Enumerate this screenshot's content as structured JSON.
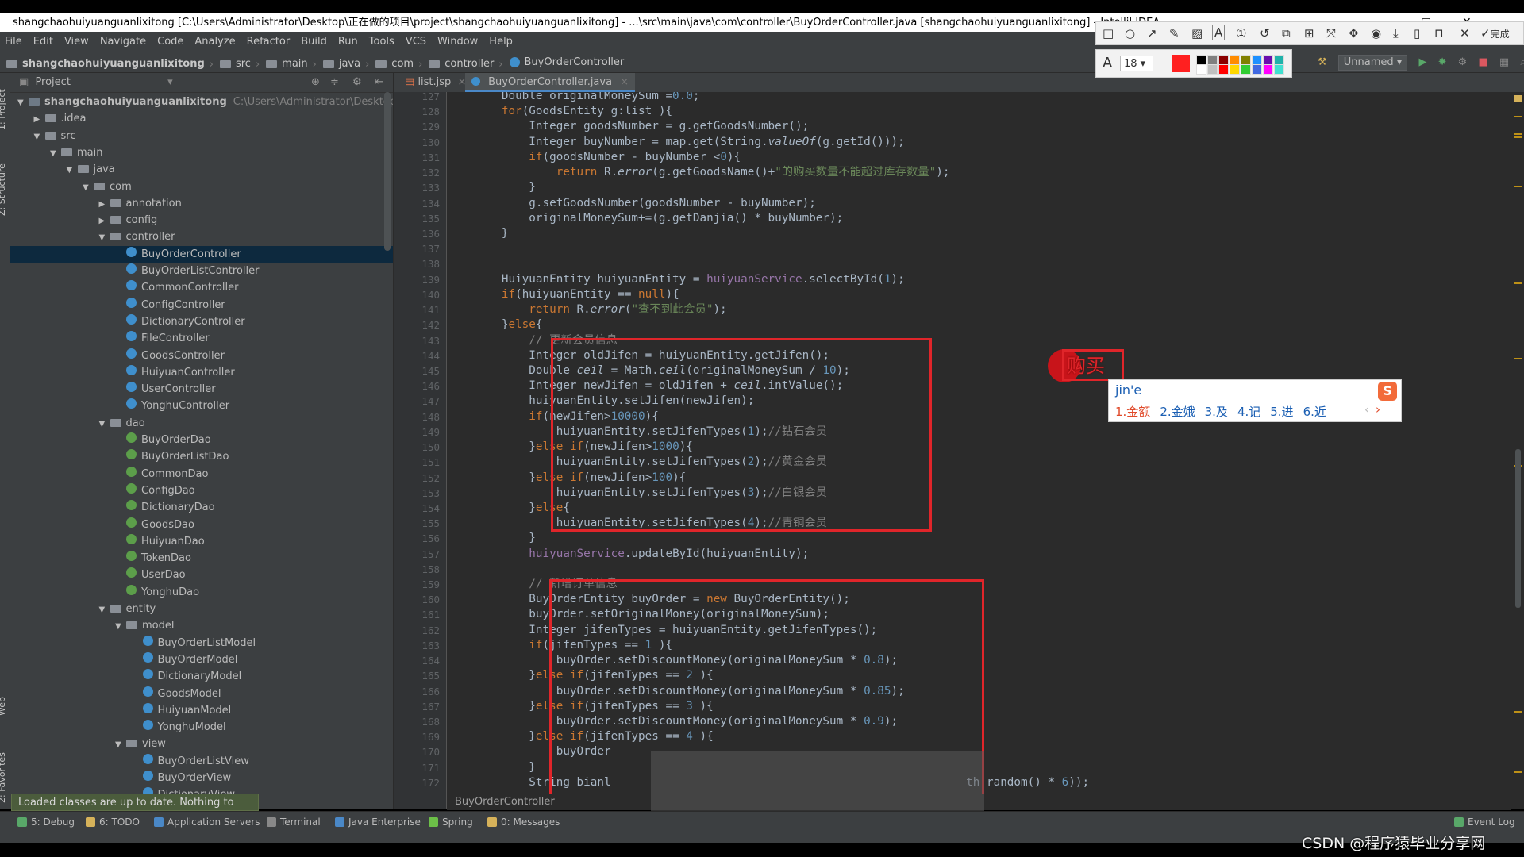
{
  "window_title": "shangchaohuiyuanguanlixitong [C:\\Users\\Administrator\\Desktop\\正在做的项目\\project\\shangchaohuiyuanguanlixitong] - ...\\src\\main\\java\\com\\controller\\BuyOrderController.java [shangchaohuiyuanguanlixitong] - IntelliJ IDEA",
  "menu": [
    "File",
    "Edit",
    "View",
    "Navigate",
    "Code",
    "Analyze",
    "Refactor",
    "Build",
    "Run",
    "Tools",
    "VCS",
    "Window",
    "Help"
  ],
  "breadcrumbs": [
    "shangchaohuiyuanguanlixitong",
    "src",
    "main",
    "java",
    "com",
    "controller",
    "BuyOrderController"
  ],
  "run_config": "Unnamed",
  "project_panel": {
    "title": "Project",
    "root_name": "shangchaohuiyuanguanlixitong",
    "root_path": "C:\\Users\\Administrator\\Desktop\\正在做",
    "tree": [
      {
        "label": "shangchaohuiyuanguanlixitong",
        "depth": 0,
        "kind": "module",
        "arrow": "▼"
      },
      {
        "label": ".idea",
        "depth": 1,
        "kind": "folder",
        "arrow": "▶"
      },
      {
        "label": "src",
        "depth": 1,
        "kind": "folder",
        "arrow": "▼"
      },
      {
        "label": "main",
        "depth": 2,
        "kind": "folder",
        "arrow": "▼"
      },
      {
        "label": "java",
        "depth": 3,
        "kind": "folder",
        "arrow": "▼"
      },
      {
        "label": "com",
        "depth": 4,
        "kind": "folder",
        "arrow": "▼"
      },
      {
        "label": "annotation",
        "depth": 5,
        "kind": "folder",
        "arrow": "▶"
      },
      {
        "label": "config",
        "depth": 5,
        "kind": "folder",
        "arrow": "▶"
      },
      {
        "label": "controller",
        "depth": 5,
        "kind": "folder",
        "arrow": "▼"
      },
      {
        "label": "BuyOrderController",
        "depth": 6,
        "kind": "class",
        "arrow": "",
        "selected": true
      },
      {
        "label": "BuyOrderListController",
        "depth": 6,
        "kind": "class",
        "arrow": ""
      },
      {
        "label": "CommonController",
        "depth": 6,
        "kind": "class",
        "arrow": ""
      },
      {
        "label": "ConfigController",
        "depth": 6,
        "kind": "class",
        "arrow": ""
      },
      {
        "label": "DictionaryController",
        "depth": 6,
        "kind": "class",
        "arrow": ""
      },
      {
        "label": "FileController",
        "depth": 6,
        "kind": "class",
        "arrow": ""
      },
      {
        "label": "GoodsController",
        "depth": 6,
        "kind": "class",
        "arrow": ""
      },
      {
        "label": "HuiyuanController",
        "depth": 6,
        "kind": "class",
        "arrow": ""
      },
      {
        "label": "UserController",
        "depth": 6,
        "kind": "class",
        "arrow": ""
      },
      {
        "label": "YonghuController",
        "depth": 6,
        "kind": "class",
        "arrow": ""
      },
      {
        "label": "dao",
        "depth": 5,
        "kind": "folder",
        "arrow": "▼"
      },
      {
        "label": "BuyOrderDao",
        "depth": 6,
        "kind": "interface",
        "arrow": ""
      },
      {
        "label": "BuyOrderListDao",
        "depth": 6,
        "kind": "interface",
        "arrow": ""
      },
      {
        "label": "CommonDao",
        "depth": 6,
        "kind": "interface",
        "arrow": ""
      },
      {
        "label": "ConfigDao",
        "depth": 6,
        "kind": "interface",
        "arrow": ""
      },
      {
        "label": "DictionaryDao",
        "depth": 6,
        "kind": "interface",
        "arrow": ""
      },
      {
        "label": "GoodsDao",
        "depth": 6,
        "kind": "interface",
        "arrow": ""
      },
      {
        "label": "HuiyuanDao",
        "depth": 6,
        "kind": "interface",
        "arrow": ""
      },
      {
        "label": "TokenDao",
        "depth": 6,
        "kind": "interface",
        "arrow": ""
      },
      {
        "label": "UserDao",
        "depth": 6,
        "kind": "interface",
        "arrow": ""
      },
      {
        "label": "YonghuDao",
        "depth": 6,
        "kind": "interface",
        "arrow": ""
      },
      {
        "label": "entity",
        "depth": 5,
        "kind": "folder",
        "arrow": "▼"
      },
      {
        "label": "model",
        "depth": 6,
        "kind": "folder",
        "arrow": "▼"
      },
      {
        "label": "BuyOrderListModel",
        "depth": 7,
        "kind": "class",
        "arrow": ""
      },
      {
        "label": "BuyOrderModel",
        "depth": 7,
        "kind": "class",
        "arrow": ""
      },
      {
        "label": "DictionaryModel",
        "depth": 7,
        "kind": "class",
        "arrow": ""
      },
      {
        "label": "GoodsModel",
        "depth": 7,
        "kind": "class",
        "arrow": ""
      },
      {
        "label": "HuiyuanModel",
        "depth": 7,
        "kind": "class",
        "arrow": ""
      },
      {
        "label": "YonghuModel",
        "depth": 7,
        "kind": "class",
        "arrow": ""
      },
      {
        "label": "view",
        "depth": 6,
        "kind": "folder",
        "arrow": "▼"
      },
      {
        "label": "BuyOrderListView",
        "depth": 7,
        "kind": "class",
        "arrow": ""
      },
      {
        "label": "BuyOrderView",
        "depth": 7,
        "kind": "class",
        "arrow": ""
      },
      {
        "label": "DictionaryView",
        "depth": 7,
        "kind": "class",
        "arrow": ""
      }
    ]
  },
  "left_tool_tabs": [
    "1: Project",
    "Z: Structure",
    "Web",
    "2: Favorites"
  ],
  "editor_tabs": [
    {
      "label": "list.jsp",
      "active": false
    },
    {
      "label": "BuyOrderController.java",
      "active": true
    }
  ],
  "code": {
    "first_line": 127,
    "lines": [
      "        Double originalMoneySum =0.0;",
      "        for(GoodsEntity g:list ){",
      "            Integer goodsNumber = g.getGoodsNumber();",
      "            Integer buyNumber = map.get(String.valueOf(g.getId()));",
      "            if(goodsNumber - buyNumber <0){",
      "                return R.error(g.getGoodsName()+\"的购买数量不能超过库存数量\");",
      "            }",
      "            g.setGoodsNumber(goodsNumber - buyNumber);",
      "            originalMoneySum+=(g.getDanjia() * buyNumber);",
      "        }",
      "",
      "",
      "        HuiyuanEntity huiyuanEntity = huiyuanService.selectById(1);",
      "        if(huiyuanEntity == null){",
      "            return R.error(\"查不到此会员\");",
      "        }else{",
      "            // 更新会员信息",
      "            Integer oldJifen = huiyuanEntity.getJifen();",
      "            Double ceil = Math.ceil(originalMoneySum / 10);",
      "            Integer newJifen = oldJifen + ceil.intValue();",
      "            huiyuanEntity.setJifen(newJifen);",
      "            if(newJifen>10000){",
      "                huiyuanEntity.setJifenTypes(1);//钻石会员",
      "            }else if(newJifen>1000){",
      "                huiyuanEntity.setJifenTypes(2);//黄金会员",
      "            }else if(newJifen>100){",
      "                huiyuanEntity.setJifenTypes(3);//白银会员",
      "            }else{",
      "                huiyuanEntity.setJifenTypes(4);//青铜会员",
      "            }",
      "            huiyuanService.updateById(huiyuanEntity);",
      "",
      "            // 新增订单信息",
      "            BuyOrderEntity buyOrder = new BuyOrderEntity();",
      "            buyOrder.setOriginalMoney(originalMoneySum);",
      "            Integer jifenTypes = huiyuanEntity.getJifenTypes();",
      "            if(jifenTypes == 1 ){",
      "                buyOrder.setDiscountMoney(originalMoneySum * 0.8);",
      "            }else if(jifenTypes == 2 ){",
      "                buyOrder.setDiscountMoney(originalMoneySum * 0.85);",
      "            }else if(jifenTypes == 3 ){",
      "                buyOrder.setDiscountMoney(originalMoneySum * 0.9);",
      "            }else if(jifenTypes == 4 ){",
      "                buyOrder",
      "            }",
      "            String bianl                                                    th.random() * 6));"
    ]
  },
  "editor_breadcrumb": "BuyOrderController",
  "notification": "Loaded classes are up to date. Nothing to reload.",
  "bottom_tabs": [
    {
      "label": "5: Debug",
      "icon": "bug-icon"
    },
    {
      "label": "6: TODO",
      "icon": "todo-icon"
    },
    {
      "label": "Application Servers",
      "icon": "server-icon"
    },
    {
      "label": "Terminal",
      "icon": "terminal-icon"
    },
    {
      "label": "Java Enterprise",
      "icon": "java-ee-icon"
    },
    {
      "label": "Spring",
      "icon": "spring-icon"
    },
    {
      "label": "0: Messages",
      "icon": "messages-icon"
    }
  ],
  "event_log": "Event Log",
  "screenshot_tool": {
    "font_size": "18",
    "done_label": "完成",
    "colors": [
      "#ff2020",
      "#000000",
      "#808080",
      "#8b0000",
      "#ff8c00",
      "#808000",
      "#1e90ff",
      "#6a0dad",
      "#20b2aa",
      "#ffffff",
      "#c0c0c0",
      "#ff0000",
      "#ffd700",
      "#32cd32",
      "#4169e1",
      "#ff00ff",
      "#40e0d0"
    ]
  },
  "annotation_badge": "购买",
  "ime": {
    "pinyin": "jin'e",
    "candidates": [
      "1.金额",
      "2.金娥",
      "3.及",
      "4.记",
      "5.进",
      "6.近"
    ]
  },
  "watermark": "CSDN @程序猿毕业分享网",
  "accent": {
    "selection": "#0d293e",
    "red_annotation": "#e0252a",
    "tab_underline": "#4a88c7"
  }
}
